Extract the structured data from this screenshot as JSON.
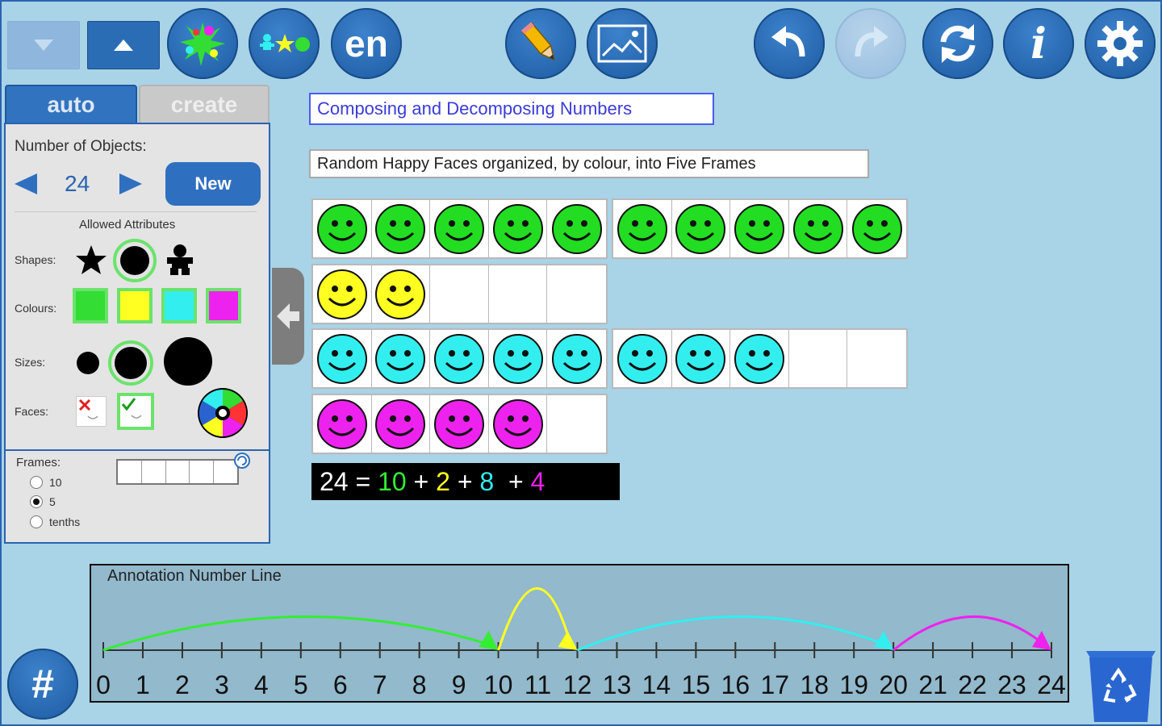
{
  "toolbar": {
    "language_label": "en",
    "info_label": "i"
  },
  "tabs": [
    {
      "label": "auto",
      "active": true
    },
    {
      "label": "create",
      "active": false
    }
  ],
  "panel": {
    "num_objects_label": "Number of Objects:",
    "num_objects_value": "24",
    "new_button_label": "New",
    "allowed_attributes_label": "Allowed Attributes",
    "shapes_label": "Shapes:",
    "colours_label": "Colours:",
    "sizes_label": "Sizes:",
    "faces_label": "Faces:",
    "frames_label": "Frames:",
    "frame_options": [
      "10",
      "5",
      "tenths"
    ],
    "frame_selected": "5",
    "colour_swatches": [
      "#33dd33",
      "#ffff22",
      "#33eeee",
      "#ee22ee"
    ]
  },
  "main": {
    "title": "Composing and Decomposing Numbers",
    "subtitle": "Random Happy Faces organized, by colour, into Five Frames"
  },
  "face_groups": [
    {
      "colour": "green",
      "hex": "#22dd22",
      "count": 10
    },
    {
      "colour": "yellow",
      "hex": "#ffff22",
      "count": 2
    },
    {
      "colour": "cyan",
      "hex": "#33eeee",
      "count": 8
    },
    {
      "colour": "magenta",
      "hex": "#ee22ee",
      "count": 4
    }
  ],
  "equation": {
    "total": "24 =",
    "terms": [
      {
        "value": "10",
        "hex": "#33ee33"
      },
      {
        "value": "2",
        "hex": "#ffff22"
      },
      {
        "value": "8",
        "hex": "#33eeee"
      },
      {
        "value": "4",
        "hex": "#ee22ee"
      }
    ],
    "plus": "+"
  },
  "number_line": {
    "title": "Annotation Number Line",
    "min": 0,
    "max": 24,
    "ticks": [
      "0",
      "1",
      "2",
      "3",
      "4",
      "5",
      "6",
      "7",
      "8",
      "9",
      "10",
      "11",
      "12",
      "13",
      "14",
      "15",
      "16",
      "17",
      "18",
      "19",
      "20",
      "21",
      "22",
      "23",
      "24"
    ],
    "jumps": [
      {
        "from": 0,
        "to": 10,
        "hex": "#33ee33"
      },
      {
        "from": 10,
        "to": 12,
        "hex": "#ffff22"
      },
      {
        "from": 12,
        "to": 20,
        "hex": "#33eeee"
      },
      {
        "from": 20,
        "to": 24,
        "hex": "#ee22ee"
      }
    ]
  },
  "bottom": {
    "hash_label": "#"
  }
}
